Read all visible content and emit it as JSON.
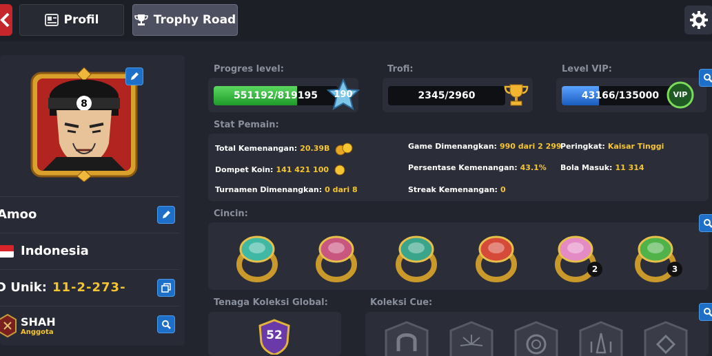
{
  "header": {
    "tab_profil": "Profil",
    "tab_trophy": "Trophy Road"
  },
  "profile": {
    "name": "Amoo",
    "country": "Indonesia",
    "id_label": "D Unik:",
    "id_value": "11-2-273-",
    "club_name": "SHAH",
    "club_role": "Anggota"
  },
  "progress": {
    "level_label": "Progres level:",
    "level_value": "551192/819195",
    "level_fraction": 0.673,
    "level_number": "190",
    "trophy_label": "Trofi:",
    "trophy_value": "2345/2960",
    "vip_label": "Level VIP:",
    "vip_value": "43166/135000",
    "vip_fraction": 0.32,
    "vip_badge": "VIP"
  },
  "stats": {
    "section_label": "Stat Pemain:",
    "total_wins_label": "Total Kemenangan:",
    "total_wins_value": "20.39B",
    "wallet_label": "Dompet Koin:",
    "wallet_value": "141 421 100",
    "tournaments_label": "Turnamen Dimenangkan:",
    "tournaments_value": "0 dari 8",
    "games_won_label": "Game Dimenangkan:",
    "games_won_value": "990 dari 2 299",
    "win_pct_label": "Persentase Kemenangan:",
    "win_pct_value": "43.1%",
    "streak_label": "Streak Kemenangan:",
    "streak_value": "0",
    "rank_label": "Peringkat:",
    "rank_value": "Kaisar Tinggi",
    "balls_label": "Bola Masuk:",
    "balls_value": "11 314"
  },
  "rings": {
    "section_label": "Cincin:",
    "items": [
      {
        "color": "#3fb8a4",
        "count": ""
      },
      {
        "color": "#c8567f",
        "count": ""
      },
      {
        "color": "#3aa58a",
        "count": ""
      },
      {
        "color": "#d64a3a",
        "count": ""
      },
      {
        "color": "#e48ac4",
        "count": "2"
      },
      {
        "color": "#4fb34a",
        "count": "3"
      }
    ]
  },
  "collection": {
    "global_label": "Tenaga Koleksi Global:",
    "global_value": "52",
    "cue_label": "Koleksi Cue:"
  },
  "colors": {
    "accent_blue": "#1e6fc7",
    "gold": "#f5c531",
    "level_bar": "#2fbd3a",
    "vip_bar": "#2a7de0"
  }
}
